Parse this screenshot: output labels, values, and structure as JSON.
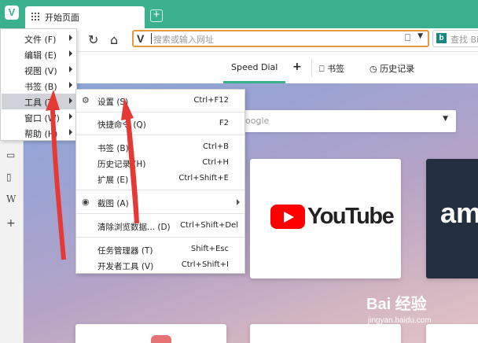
{
  "browser": {
    "tab_title": "开始页面",
    "new_tab": "+",
    "address_placeholder": "搜索或输入网址",
    "search_placeholder": "查找 Bi"
  },
  "speed_dial": {
    "tab_label": "Speed Dial",
    "add": "+",
    "bookmarks": "书签",
    "history": "历史记录",
    "search_placeholder": "oogle",
    "tiles": [
      "YouTube",
      "am"
    ]
  },
  "main_menu": {
    "items": [
      {
        "label": "文件 (F)"
      },
      {
        "label": "编辑 (E)"
      },
      {
        "label": "视图 (V)"
      },
      {
        "label": "书签 (B)"
      },
      {
        "label": "工具 (T)"
      },
      {
        "label": "窗口 (W)"
      },
      {
        "label": "帮助 (H)"
      }
    ]
  },
  "tools_menu": {
    "items": [
      {
        "label": "设置 (S)",
        "shortcut": "Ctrl+F12"
      },
      {
        "label": "快捷命令 (Q)",
        "shortcut": "F2"
      },
      {
        "label": "书签 (B)",
        "shortcut": "Ctrl+B"
      },
      {
        "label": "历史记录 (H)",
        "shortcut": "Ctrl+H"
      },
      {
        "label": "扩展 (E)",
        "shortcut": "Ctrl+Shift+E"
      },
      {
        "label": "截图 (A)",
        "shortcut": ""
      },
      {
        "label": "清除浏览数据... (D)",
        "shortcut": "Ctrl+Shift+Del"
      },
      {
        "label": "任务管理器 (T)",
        "shortcut": "Shift+Esc"
      },
      {
        "label": "开发者工具 (V)",
        "shortcut": "Ctrl+Shift+I"
      }
    ]
  },
  "watermark": {
    "brand": "Bai 经验",
    "url": "jingyan.baidu.com"
  },
  "colors": {
    "accent": "#3bb08f",
    "url_focus": "#e39a3d",
    "annotation_arrow": "#e53935",
    "youtube_red": "#ff0000"
  }
}
